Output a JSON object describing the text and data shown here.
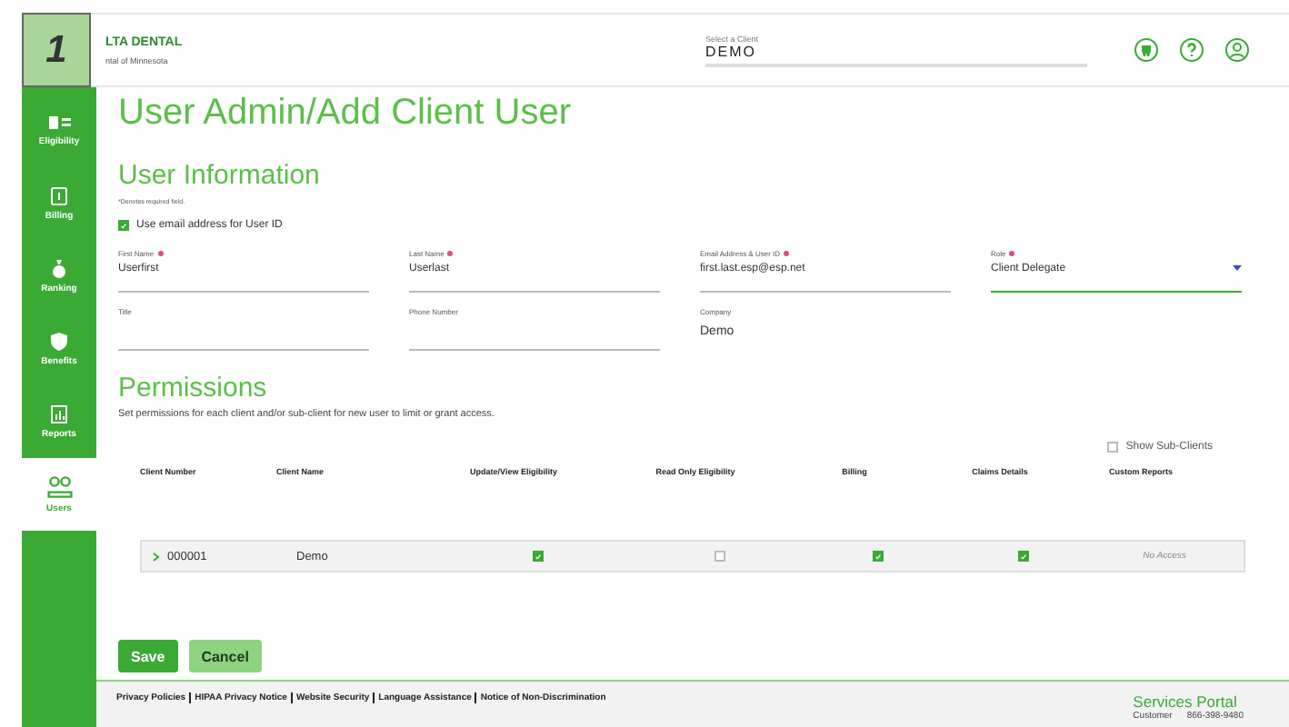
{
  "badge": "1",
  "header": {
    "logo_title": "LTA DENTAL",
    "logo_subtitle": "ntal of Minnesota",
    "client_select": {
      "label": "Select a Client",
      "value": "DEMO"
    }
  },
  "sidebar": {
    "items": [
      {
        "label": "Eligibility",
        "selected": false
      },
      {
        "label": "Billing",
        "selected": false
      },
      {
        "label": "Ranking",
        "selected": false
      },
      {
        "label": "Benefits",
        "selected": false
      },
      {
        "label": "Reports",
        "selected": false
      },
      {
        "label": "Users",
        "selected": true
      }
    ]
  },
  "page_title": "User Admin/Add Client User",
  "user_information": {
    "title": "User Information",
    "note": "*Denotes required field.",
    "use_email": {
      "label": "Use email address for User ID",
      "checked": true
    },
    "fields": [
      {
        "label": "First Name",
        "required": true,
        "value": "Userfirst",
        "kind": "text"
      },
      {
        "label": "Last Name",
        "required": true,
        "value": "Userlast",
        "kind": "text"
      },
      {
        "label": "Email Address & User ID",
        "required": true,
        "value": "first.last.esp@esp.net",
        "kind": "text"
      },
      {
        "label": "Role",
        "required": true,
        "value": "Client Delegate",
        "kind": "select"
      },
      {
        "label": "Title",
        "required": false,
        "kind": "text"
      },
      {
        "label": "Phone Number",
        "required": false,
        "kind": "text"
      },
      {
        "label": "Company",
        "required": false,
        "value": "Demo",
        "kind": "static"
      }
    ]
  },
  "permissions": {
    "title": "Permissions",
    "description": "Set permissions for each client and/or sub-client for new user to limit or grant access.",
    "show_sub_clients": {
      "label": "Show Sub-Clients",
      "checked": false
    },
    "columns": [
      "Client Number",
      "Client Name",
      "Update/View Eligibility",
      "Read Only Eligibility",
      "Billing",
      "Claims Details",
      "Custom Reports"
    ],
    "rows": [
      {
        "expanded": false,
        "cells": [
          {
            "kind": "client",
            "text": "000001"
          },
          {
            "kind": "text",
            "text": "Demo"
          },
          {
            "kind": "checkbox",
            "checked": true
          },
          {
            "kind": "checkbox",
            "checked": false
          },
          {
            "kind": "checkbox",
            "checked": true
          },
          {
            "kind": "checkbox",
            "checked": true
          },
          {
            "kind": "note",
            "text": "No Access"
          }
        ]
      }
    ]
  },
  "buttons": [
    {
      "label": "Save",
      "kind": "primary"
    },
    {
      "label": "Cancel",
      "kind": "secondary"
    }
  ],
  "footer": {
    "links": [
      "Privacy Policies",
      "HIPAA Privacy Notice",
      "Website Security",
      "Language Assistance",
      "Notice of Non-Discrimination"
    ],
    "portal_title": "Services Portal",
    "contact_label": "Customer",
    "contact_phone": "866-398-9480"
  }
}
